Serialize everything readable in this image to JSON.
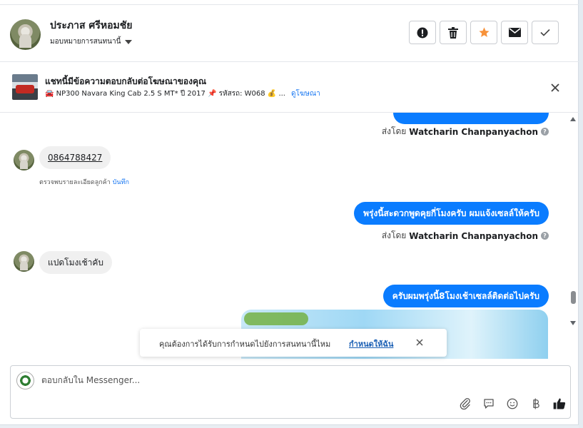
{
  "header": {
    "name": "ประภาส ศรีหอมชัย",
    "assign_label": "มอบหมายการสนทนานี้",
    "actions": [
      "spam-icon",
      "delete-icon",
      "star-icon",
      "mark-unread-icon",
      "done-icon"
    ]
  },
  "ad_banner": {
    "title": "แชทนี้มีข้อความตอบกลับต่อโฆษณาของคุณ",
    "subtitle": "🚘 NP300 Navara King Cab 2.5 S MT* ปี 2017 📌 รหัสรถ: W068 💰 ...",
    "link": "ดูโฆษณา"
  },
  "messages": {
    "sent_by_prefix": "ส่งโดย",
    "sender": "Watcharin Chanpanyachon",
    "incoming_1": "0864788427",
    "note_text": "ตรวจพบรายละเอียดลูกค้า",
    "note_link": "บันทึก",
    "outgoing_2": "พรุ่งนี้สะดวกพูดคุยกี่โมงครับ ผมแจ้งเซลล์ให้ครับ",
    "incoming_2": "แปดโมงเช้าคับ",
    "outgoing_3": "ครับผมพรุ่งนี้8โมงเช้าเซลล์ติดต่อไปครับ"
  },
  "toast": {
    "text": "คุณต้องการได้รับการกำหนดไปยังการสนทนานี้ไหม",
    "link": "กำหนดให้ฉัน"
  },
  "composer": {
    "placeholder": "ตอบกลับใน Messenger...",
    "tools": [
      "attachment-icon",
      "saved-reply-icon",
      "emoji-icon",
      "payment-icon",
      "like-icon"
    ]
  },
  "colors": {
    "accent": "#0a7cff",
    "link": "#1877f2",
    "star": "#f7923a"
  }
}
